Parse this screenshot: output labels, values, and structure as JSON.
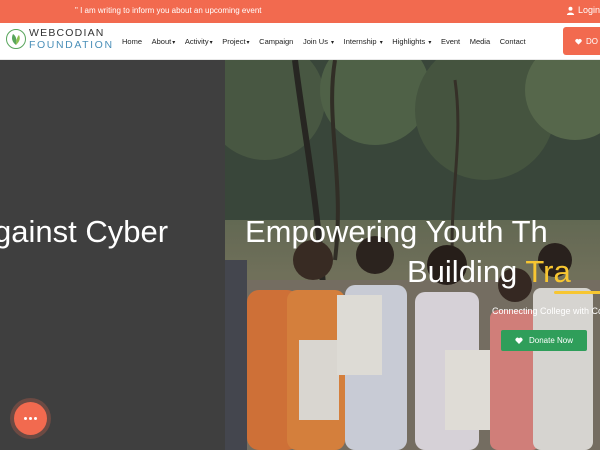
{
  "topbar": {
    "announcement": "\" I am writing to inform you about an upcoming event",
    "login_label": "Login"
  },
  "brand": {
    "line1": "WEBCODIAN",
    "line2": "FOUNDATION"
  },
  "nav": {
    "items": [
      {
        "label": "Home",
        "dropdown": false
      },
      {
        "label": "About",
        "dropdown": true
      },
      {
        "label": "Activity",
        "dropdown": true
      },
      {
        "label": "Project",
        "dropdown": true
      },
      {
        "label": "Campaign",
        "dropdown": false
      },
      {
        "label": "Join Us",
        "dropdown": true
      },
      {
        "label": "Internship",
        "dropdown": true
      },
      {
        "label": "Highlights",
        "dropdown": true
      },
      {
        "label": "Event",
        "dropdown": false
      },
      {
        "label": "Media",
        "dropdown": false
      },
      {
        "label": "Contact",
        "dropdown": false
      }
    ],
    "donate_label": "DO"
  },
  "hero": {
    "prev_slide_title": "gainst Cyber",
    "title_line1": "Empowering Youth Th",
    "title_line2_plain": "Building ",
    "title_line2_accent": "Tra",
    "subtitle": "Connecting College with Comm",
    "donate_label": "Donate Now"
  },
  "colors": {
    "brand_orange": "#f26a4f",
    "accent_yellow": "#f7c631",
    "donate_green": "#2f9e5a",
    "slide_gray": "#3f3f3f"
  },
  "icons": {
    "login": "user-icon",
    "donate": "heart-icon",
    "fab": "more-dots-icon",
    "logo": "leaf-icon"
  }
}
